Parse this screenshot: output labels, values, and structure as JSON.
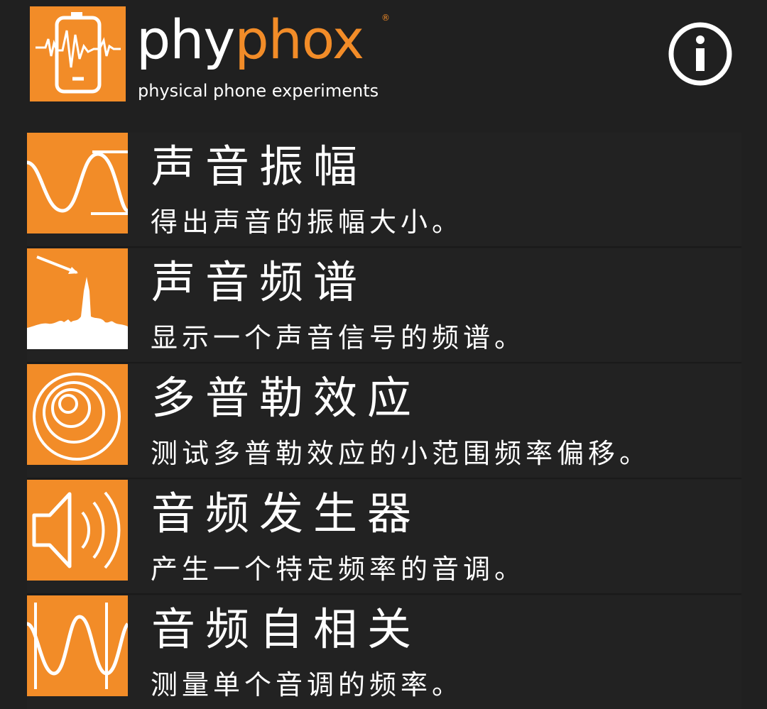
{
  "app": {
    "logo_text_phy": "phy",
    "logo_text_phox": "phox",
    "logo_registered": "®",
    "tagline": "physical phone experiments",
    "accent_color": "#f28c28",
    "info_icon": "info-icon"
  },
  "experiments": [
    {
      "title": "声音振幅",
      "description": "得出声音的振幅大小。",
      "icon": "sine-amplitude-icon"
    },
    {
      "title": "声音频谱",
      "description": "显示一个声音信号的频谱。",
      "icon": "spectrum-icon"
    },
    {
      "title": "多普勒效应",
      "description": "测试多普勒效应的小范围频率偏移。",
      "icon": "concentric-circles-icon"
    },
    {
      "title": "音频发生器",
      "description": "产生一个特定频率的音调。",
      "icon": "speaker-icon"
    },
    {
      "title": "音频自相关",
      "description": "测量单个音调的频率。",
      "icon": "sine-period-icon"
    }
  ]
}
